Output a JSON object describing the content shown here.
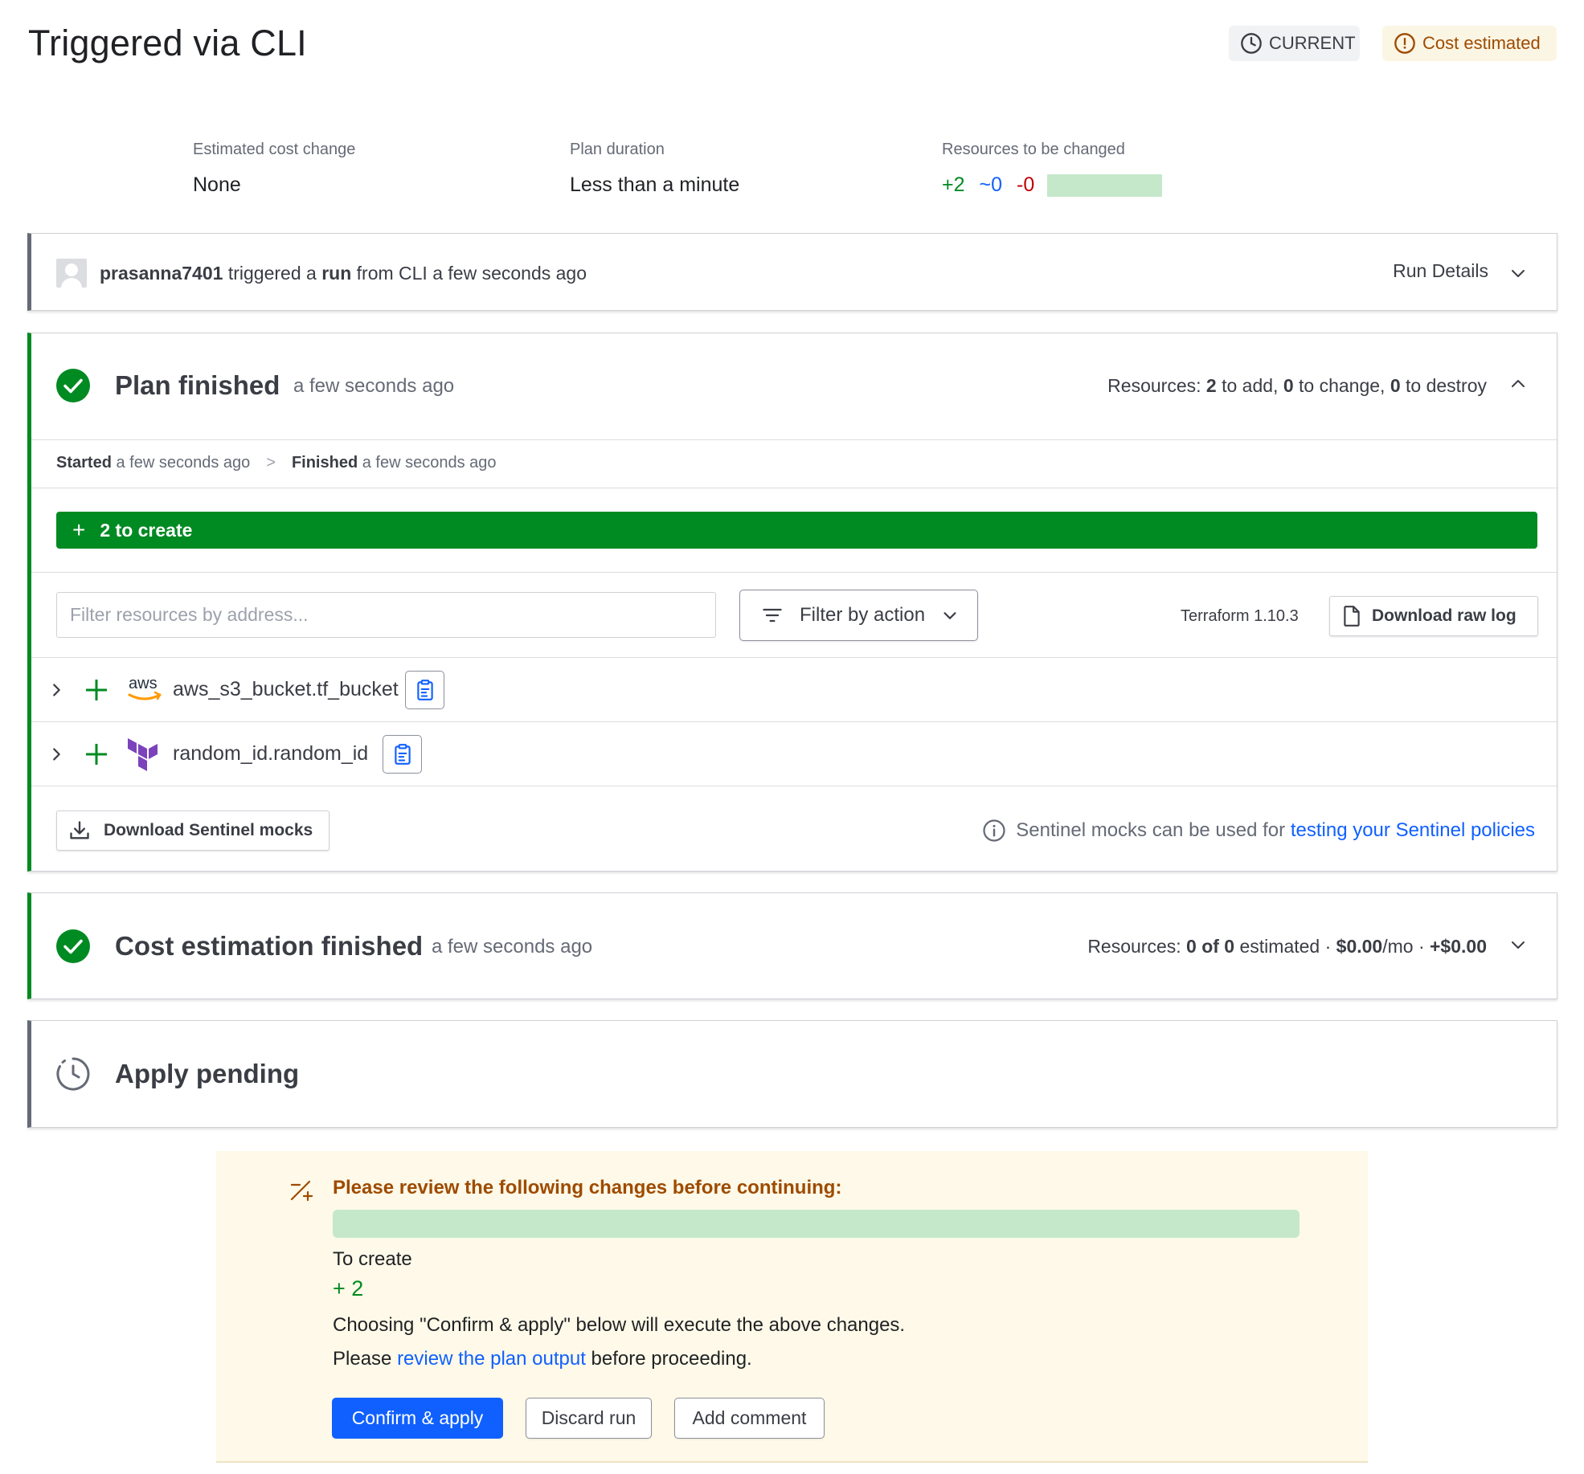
{
  "header": {
    "title": "Triggered via CLI",
    "status_badge": "CURRENT",
    "cost_badge": "Cost estimated"
  },
  "summary": {
    "cost_label": "Estimated cost change",
    "cost_value": "None",
    "duration_label": "Plan duration",
    "duration_value": "Less than a minute",
    "resources_label": "Resources to be changed",
    "add": "+2",
    "change": "~0",
    "destroy": "-0"
  },
  "trigger": {
    "user": "prasanna7401",
    "text1": "triggered a",
    "run": "run",
    "text2": "from CLI a few seconds ago",
    "details": "Run Details"
  },
  "plan": {
    "title": "Plan finished",
    "time": "a few seconds ago",
    "res_prefix": "Resources: ",
    "add_count": "2",
    "add_text": " to add, ",
    "change_count": "0",
    "change_text": " to change, ",
    "destroy_count": "0",
    "destroy_text": " to destroy",
    "started_label": "Started",
    "started_time": " a few seconds ago",
    "finished_label": "Finished",
    "finished_time": " a few seconds ago",
    "create_bar": "2 to create",
    "filter_placeholder": "Filter resources by address...",
    "filter_action": "Filter by action",
    "tf_version": "Terraform 1.10.3",
    "download_raw": "Download raw log",
    "resources": [
      {
        "address": "aws_s3_bucket.tf_bucket",
        "provider_label": "aws"
      },
      {
        "address": "random_id.random_id"
      }
    ],
    "sentinel_button": "Download Sentinel mocks",
    "sentinel_note": "Sentinel mocks can be used for ",
    "sentinel_link": "testing your Sentinel policies"
  },
  "cost": {
    "title": "Cost estimation finished",
    "time": "a few seconds ago",
    "res_prefix": "Resources: ",
    "estimated_count": "0 of 0",
    "estimated_text": " estimated · ",
    "monthly": "$0.00",
    "monthly_suffix": "/mo · ",
    "delta": "+$0.00"
  },
  "apply": {
    "title": "Apply pending"
  },
  "review": {
    "title": "Please review the following changes before continuing:",
    "to_create_label": "To create",
    "to_create_count": "+ 2",
    "line1": "Choosing \"Confirm & apply\" below will execute the above changes.",
    "line2_pre": "Please ",
    "line2_link": "review the plan output",
    "line2_post": " before proceeding.",
    "confirm": "Confirm & apply",
    "discard": "Discard run",
    "comment": "Add comment"
  },
  "colors": {
    "green": "#008a22",
    "blue": "#1060ff",
    "red": "#c00005",
    "warning": "#9e4b00"
  }
}
